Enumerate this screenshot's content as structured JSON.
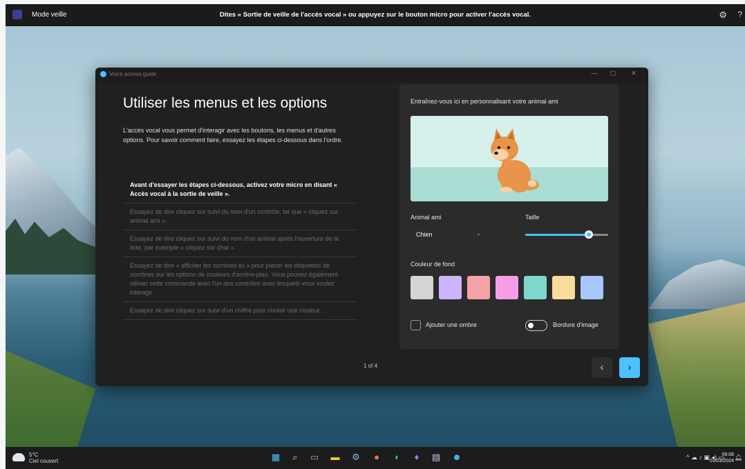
{
  "voice_bar": {
    "mode": "Mode veille",
    "message": "Dites « Sortie de veille de l'accès vocal » ou appuyez sur le bouton micro pour activer l'accès vocal.",
    "help": "?"
  },
  "window": {
    "title": "Voice access guide",
    "controls": {
      "minimize": "—",
      "maximize": "▢",
      "close": "✕"
    }
  },
  "guide": {
    "heading": "Utiliser les menus et les options",
    "intro": "L'accès vocal vous permet d'interagir avec les boutons, les menus et d'autres options. Pour savoir comment faire, essayez les étapes ci-dessous dans l'ordre.",
    "steps": [
      "Avant d'essayer les étapes ci-dessous, activez votre micro en disant « Accès vocal à la sortie de veille ».",
      "Essayez de dire cliquez sur suivi du nom d'un contrôle, tel que « cliquez sur animal ami ».",
      "Essayez de dire cliquez sur suivi du nom d'un animal après l'ouverture de la liste, par exemple « cliquez sur chat ».",
      "Essayez de dire « afficher les nombres ici » pour placer les étiquettes de nombres sur les options de couleurs d'arrière-plan. Vous pouvez également utiliser cette commande avec l'un des contrôles avec lesquels vous voulez interagir.",
      "Essayez de dire cliquez sur suivi d'un chiffre pour choisir une couleur."
    ],
    "pager": "1 of 4"
  },
  "practice": {
    "title": "Entraînez-vous ici en personnalisant votre animal ami",
    "pet_label": "Animal ami",
    "pet_value": "Chien",
    "size_label": "Taille",
    "size_value": 0.8,
    "bg_label": "Couleur de fond",
    "colors": [
      "#d4d4d4",
      "#cdb4ff",
      "#f4a3a8",
      "#f59ee8",
      "#7fd6cc",
      "#f9dc9a",
      "#a6c8ff"
    ],
    "shadow_label": "Ajouter une ombre",
    "border_label": "Bordure d'image",
    "accent": "#4cc2ff"
  },
  "nav": {
    "prev": "‹",
    "next": "›"
  },
  "taskbar": {
    "temp": "5°C",
    "weather": "Ciel couvert",
    "time": "09:06",
    "date": "01/03/2024",
    "tray": "^"
  }
}
